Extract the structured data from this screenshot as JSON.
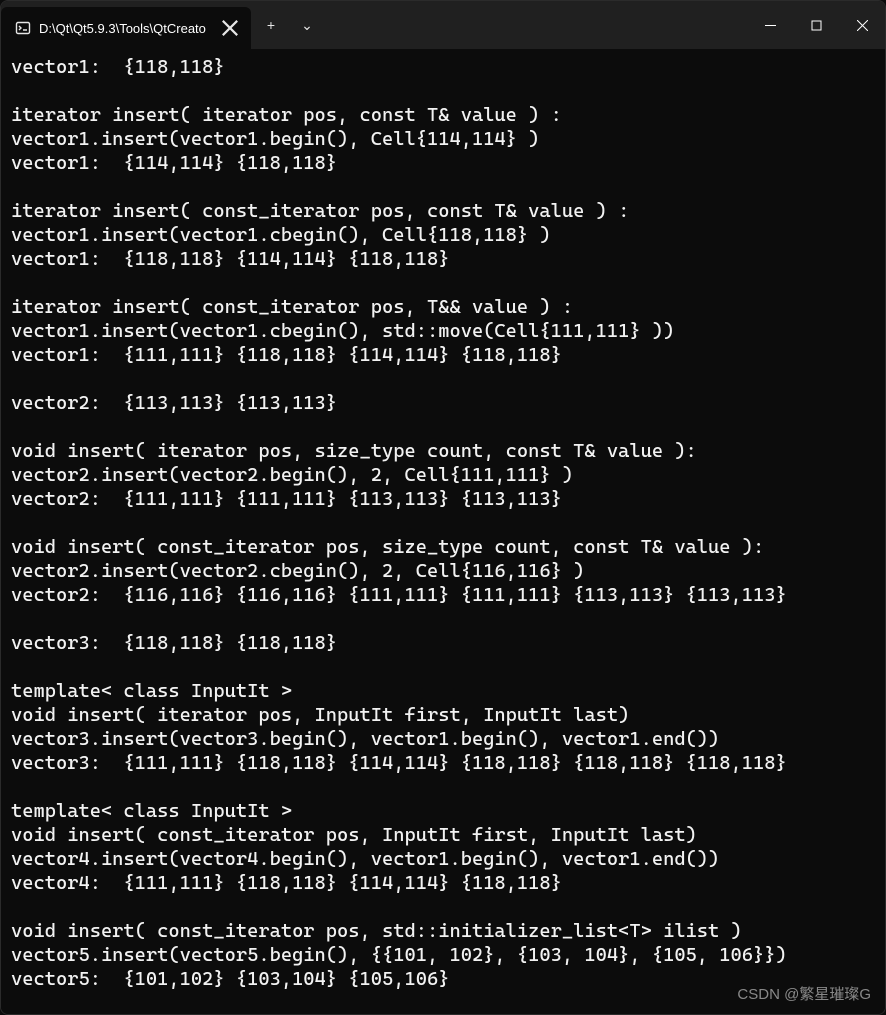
{
  "window": {
    "tab_title": "D:\\Qt\\Qt5.9.3\\Tools\\QtCreato",
    "new_tab_label": "+",
    "dropdown_label": "⌄"
  },
  "terminal": {
    "lines": [
      "vector1:  {118,118}",
      "",
      "iterator insert( iterator pos, const T& value ) :",
      "vector1.insert(vector1.begin(), Cell{114,114} )",
      "vector1:  {114,114} {118,118}",
      "",
      "iterator insert( const_iterator pos, const T& value ) :",
      "vector1.insert(vector1.cbegin(), Cell{118,118} )",
      "vector1:  {118,118} {114,114} {118,118}",
      "",
      "iterator insert( const_iterator pos, T&& value ) :",
      "vector1.insert(vector1.cbegin(), std::move(Cell{111,111} ))",
      "vector1:  {111,111} {118,118} {114,114} {118,118}",
      "",
      "vector2:  {113,113} {113,113}",
      "",
      "void insert( iterator pos, size_type count, const T& value ):",
      "vector2.insert(vector2.begin(), 2, Cell{111,111} )",
      "vector2:  {111,111} {111,111} {113,113} {113,113}",
      "",
      "void insert( const_iterator pos, size_type count, const T& value ):",
      "vector2.insert(vector2.cbegin(), 2, Cell{116,116} )",
      "vector2:  {116,116} {116,116} {111,111} {111,111} {113,113} {113,113}",
      "",
      "vector3:  {118,118} {118,118}",
      "",
      "template< class InputIt >",
      "void insert( iterator pos, InputIt first, InputIt last)",
      "vector3.insert(vector3.begin(), vector1.begin(), vector1.end())",
      "vector3:  {111,111} {118,118} {114,114} {118,118} {118,118} {118,118}",
      "",
      "template< class InputIt >",
      "void insert( const_iterator pos, InputIt first, InputIt last)",
      "vector4.insert(vector4.begin(), vector1.begin(), vector1.end())",
      "vector4:  {111,111} {118,118} {114,114} {118,118}",
      "",
      "void insert( const_iterator pos, std::initializer_list<T> ilist )",
      "vector5.insert(vector5.begin(), {{101, 102}, {103, 104}, {105, 106}})",
      "vector5:  {101,102} {103,104} {105,106}"
    ]
  },
  "watermark": "CSDN @繁星璀璨G"
}
